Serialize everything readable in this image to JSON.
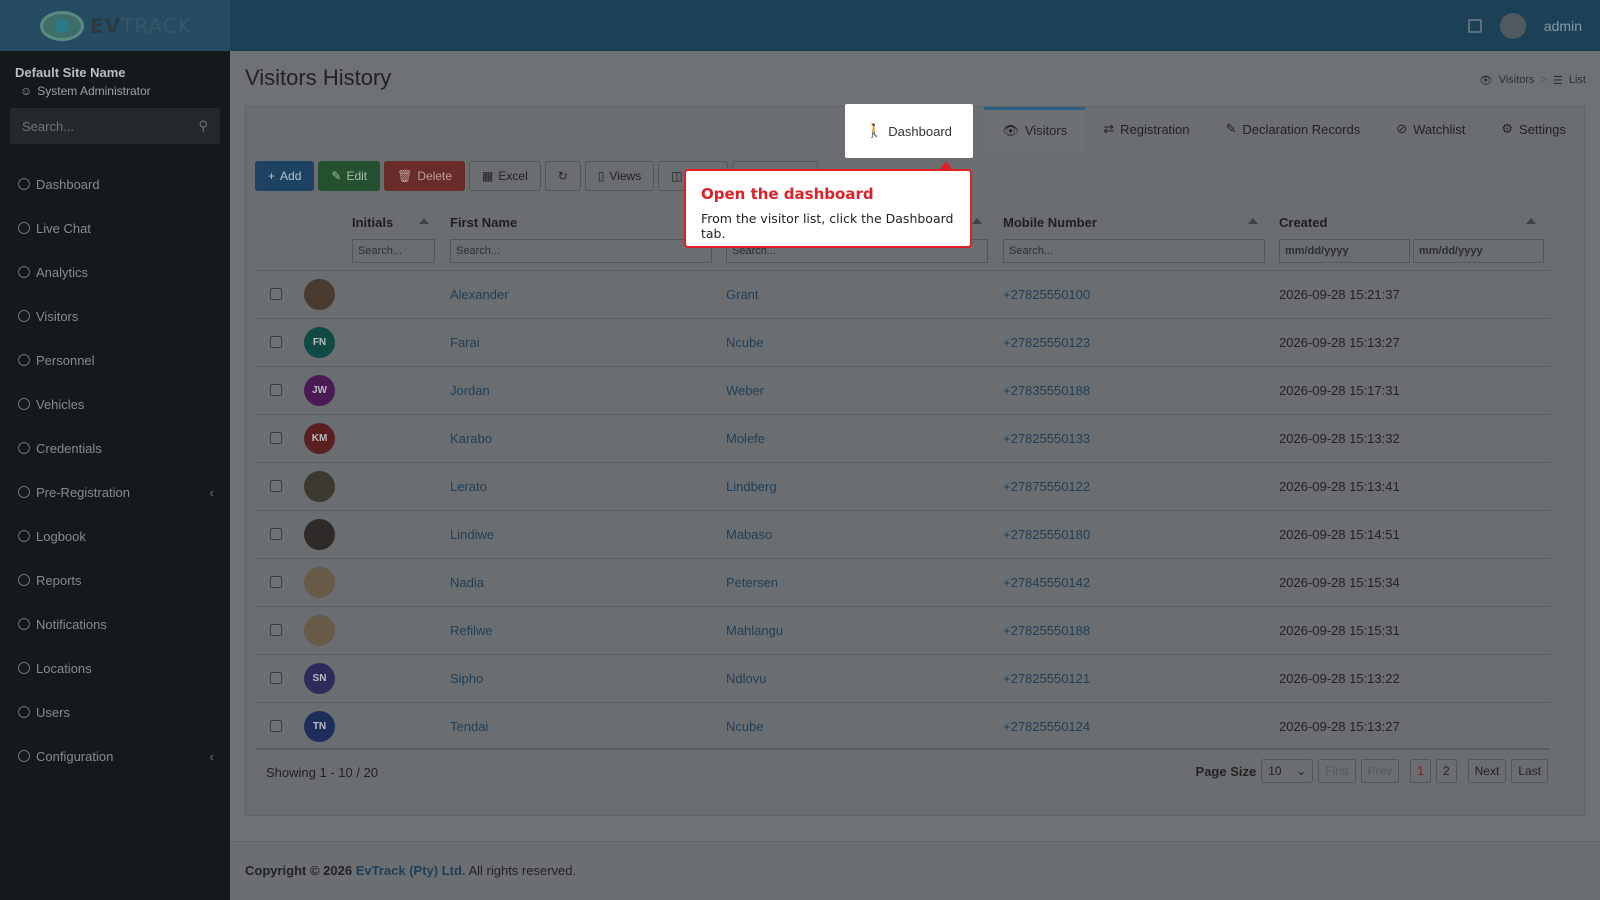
{
  "topbar": {
    "logo_bold": "EV",
    "logo_rest": "TRACK",
    "user_name": "admin"
  },
  "sidebar": {
    "site_name": "Default Site Name",
    "role": "System Administrator",
    "search_placeholder": "Search...",
    "items": [
      {
        "label": "Dashboard",
        "icon": "dashboard-icon"
      },
      {
        "label": "Live Chat",
        "icon": "headset-icon"
      },
      {
        "label": "Analytics",
        "icon": "target-icon"
      },
      {
        "label": "Visitors",
        "icon": "eye-icon"
      },
      {
        "label": "Personnel",
        "icon": "users-icon"
      },
      {
        "label": "Vehicles",
        "icon": "car-icon"
      },
      {
        "label": "Credentials",
        "icon": "id-card-icon"
      },
      {
        "label": "Pre-Registration",
        "icon": "arrows-icon"
      },
      {
        "label": "Logbook",
        "icon": "book-icon"
      },
      {
        "label": "Reports",
        "icon": "chart-icon"
      },
      {
        "label": "Notifications",
        "icon": "chat-icon"
      },
      {
        "label": "Locations",
        "icon": "building-icon"
      },
      {
        "label": "Users",
        "icon": "user-icon"
      },
      {
        "label": "Configuration",
        "icon": "gear-icon"
      }
    ]
  },
  "page": {
    "title": "Visitors History",
    "breadcrumb_1": "Visitors",
    "breadcrumb_sep": ">",
    "breadcrumb_2": "List"
  },
  "tabs": {
    "dashboard": "Dashboard",
    "visitors": "Visitors",
    "registration": "Registration",
    "declaration": "Declaration Records",
    "watchlist": "Watchlist",
    "settings": "Settings"
  },
  "toolbar": {
    "add": "Add",
    "edit": "Edit",
    "delete": "Delete",
    "excel": "Excel",
    "views": "Views"
  },
  "columns": {
    "initials": "Initials",
    "first_name": "First Name",
    "mobile": "Mobile Number",
    "created": "Created",
    "search_placeholder": "Search...",
    "date_placeholder": "mm/dd/yyyy"
  },
  "rows": [
    {
      "initials": "",
      "avatar_color": "#4a3a30",
      "first": "Alexander",
      "last": "Grant",
      "mobile": "+27825550100",
      "created": "2026-09-28 15:21:37"
    },
    {
      "initials": "FN",
      "avatar_color": "#0f4a45",
      "first": "Farai",
      "last": "Ncube",
      "mobile": "+27825550123",
      "created": "2026-09-28 15:13:27"
    },
    {
      "initials": "JW",
      "avatar_color": "#4a1a55",
      "first": "Jordan",
      "last": "Weber",
      "mobile": "+27835550188",
      "created": "2026-09-28 15:17:31"
    },
    {
      "initials": "KM",
      "avatar_color": "#5a2020",
      "first": "Karabo",
      "last": "Molefe",
      "mobile": "+27825550133",
      "created": "2026-09-28 15:13:32"
    },
    {
      "initials": "",
      "avatar_color": "#3c3a30",
      "first": "Lerato",
      "last": "Lindberg",
      "mobile": "+27875550122",
      "created": "2026-09-28 15:13:41"
    },
    {
      "initials": "",
      "avatar_color": "#2e2a28",
      "first": "Lindiwe",
      "last": "Mabaso",
      "mobile": "+27825550180",
      "created": "2026-09-28 15:14:51"
    },
    {
      "initials": "",
      "avatar_color": "#6a5a48",
      "first": "Nadia",
      "last": "Petersen",
      "mobile": "+27845550142",
      "created": "2026-09-28 15:15:34"
    },
    {
      "initials": "",
      "avatar_color": "#6a5a48",
      "first": "Refilwe",
      "last": "Mahlangu",
      "mobile": "+27825550188",
      "created": "2026-09-28 15:15:31"
    },
    {
      "initials": "SN",
      "avatar_color": "#2e2a5a",
      "first": "Sipho",
      "last": "Ndlovu",
      "mobile": "+27825550121",
      "created": "2026-09-28 15:13:22"
    },
    {
      "initials": "TN",
      "avatar_color": "#1e2e5a",
      "first": "Tendai",
      "last": "Ncube",
      "mobile": "+27825550124",
      "created": "2026-09-28 15:13:27"
    }
  ],
  "pagination": {
    "showing": "Showing 1 - 10 / 20",
    "page_size_label": "Page Size",
    "page_size": "10",
    "first": "First",
    "prev": "Prev",
    "page1": "1",
    "page2": "2",
    "next": "Next",
    "last": "Last"
  },
  "footer": {
    "copyright_prefix": "Copyright © 2026",
    "company": "EvTrack (Pty) Ltd.",
    "suffix": "All rights reserved."
  },
  "tooltip": {
    "title": "Open the dashboard",
    "body": "From the visitor list, click the Dashboard tab."
  }
}
